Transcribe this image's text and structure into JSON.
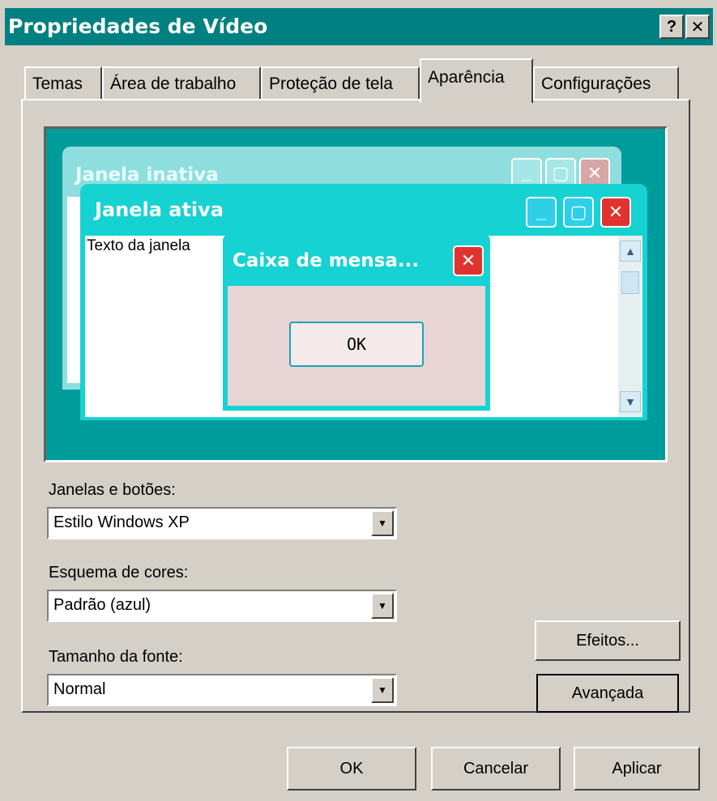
{
  "window": {
    "title": "Propriedades de Vídeo",
    "help_button": "?",
    "close_button": "✕"
  },
  "tabs": [
    {
      "label": "Temas",
      "active": false
    },
    {
      "label": "Área de trabalho",
      "active": false
    },
    {
      "label": "Proteção de tela",
      "active": false
    },
    {
      "label": "Aparência",
      "active": true
    },
    {
      "label": "Configurações",
      "active": false
    }
  ],
  "preview": {
    "inactive_window": {
      "title": "Janela inativa"
    },
    "active_window": {
      "title": "Janela ativa",
      "text": "Texto da janela"
    },
    "message_box": {
      "title": "Caixa de mensa...",
      "ok_label": "OK"
    }
  },
  "form": {
    "windows_buttons": {
      "label": "Janelas e botões:",
      "value": "Estilo Windows XP"
    },
    "color_scheme": {
      "label": "Esquema de cores:",
      "value": "Padrão (azul)"
    },
    "font_size": {
      "label": "Tamanho da fonte:",
      "value": "Normal"
    },
    "effects_label": "Efeitos...",
    "advanced_label": "Avançada"
  },
  "footer": {
    "ok_label": "OK",
    "cancel_label": "Cancelar",
    "apply_label": "Aplicar"
  },
  "colors": {
    "titlebar": "#008080",
    "dialog_bg": "#d4d0c8",
    "preview_bg": "#009c9c",
    "active_caption": "#17d2d2",
    "close_red": "#e0332f"
  }
}
